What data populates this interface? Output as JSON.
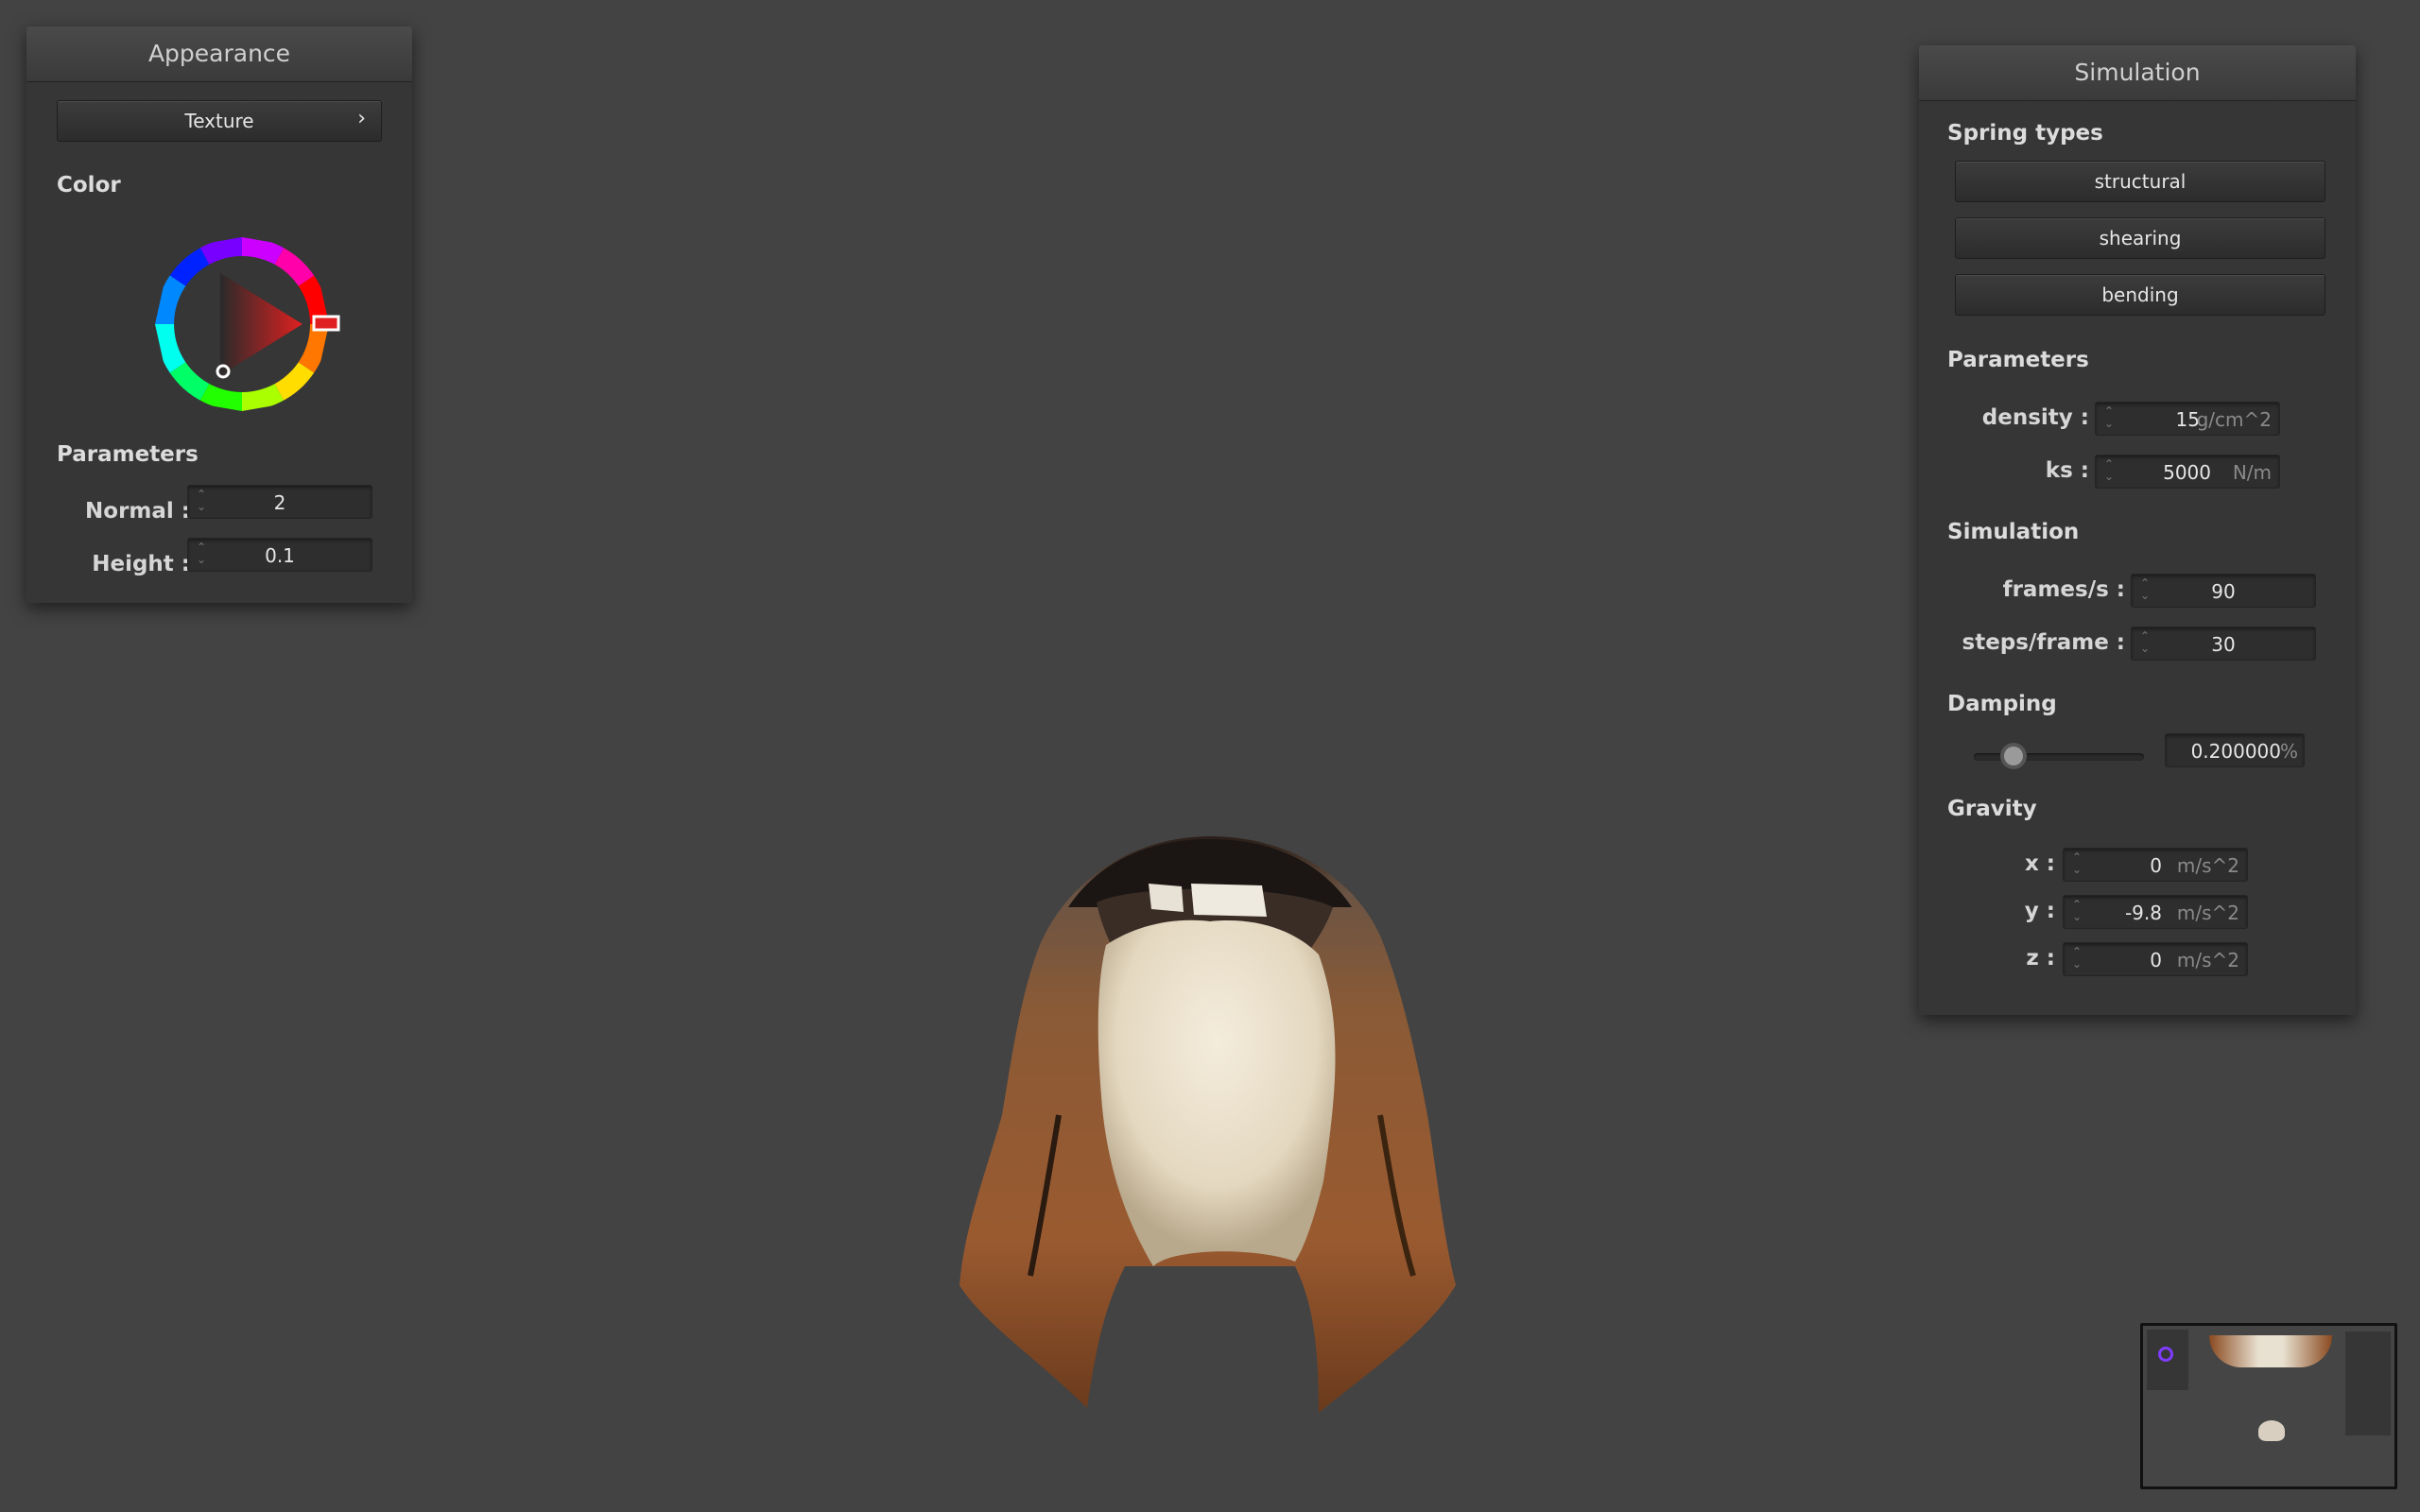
{
  "appearance": {
    "title": "Appearance",
    "texture_button": "Texture",
    "texture_chevron": "›",
    "color_label": "Color",
    "selected_color": "#e02020",
    "parameters_label": "Parameters",
    "normal": {
      "label": "Normal :",
      "value": "2"
    },
    "height": {
      "label": "Height :",
      "value": "0.1"
    }
  },
  "simulation": {
    "title": "Simulation",
    "spring_types_label": "Spring types",
    "spring_buttons": [
      "structural",
      "shearing",
      "bending"
    ],
    "parameters_label": "Parameters",
    "density": {
      "label": "density :",
      "value": "15",
      "unit": "g/cm^2"
    },
    "ks": {
      "label": "ks :",
      "value": "5000",
      "unit": "N/m"
    },
    "simulation_label": "Simulation",
    "fps": {
      "label": "frames/s :",
      "value": "90"
    },
    "steps": {
      "label": "steps/frame :",
      "value": "30"
    },
    "damping_label": "Damping",
    "damping": {
      "value": "0.200000",
      "unit": "%",
      "slider_fraction": 0.2
    },
    "gravity_label": "Gravity",
    "gravity": [
      {
        "label": "x :",
        "value": "0",
        "unit": "m/s^2"
      },
      {
        "label": "y :",
        "value": "-9.8",
        "unit": "m/s^2"
      },
      {
        "label": "z :",
        "value": "0",
        "unit": "m/s^2"
      }
    ]
  },
  "viewport": {
    "background": "#434343",
    "object": "cloth-mesh-with-fur-texture"
  }
}
